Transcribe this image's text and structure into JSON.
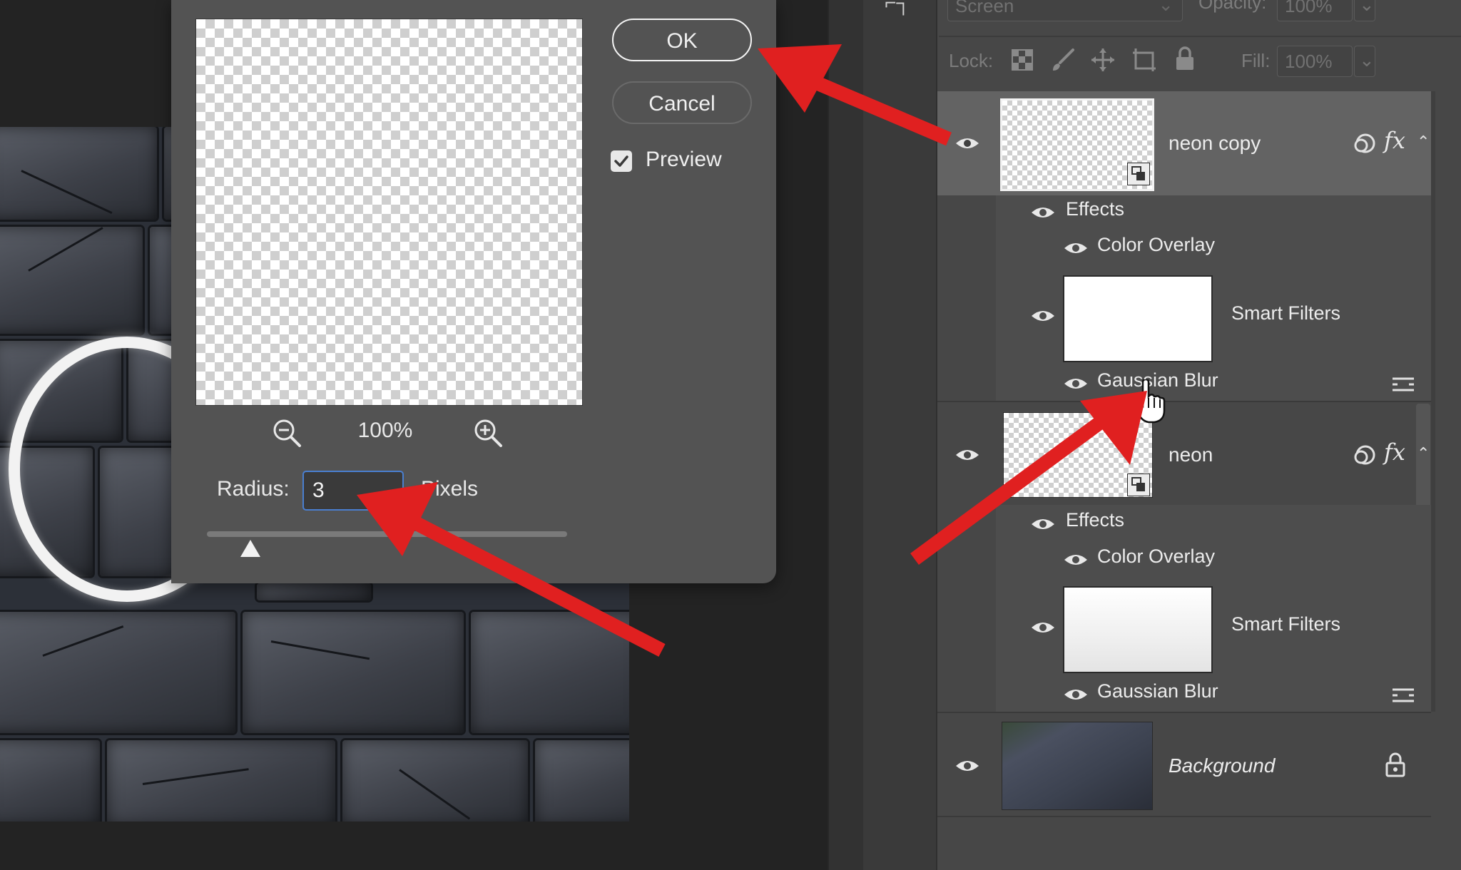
{
  "dialog": {
    "ok_label": "OK",
    "cancel_label": "Cancel",
    "preview_label": "Preview",
    "preview_checked": true,
    "zoom_level": "100%",
    "radius_label": "Radius:",
    "radius_value": "3",
    "pixels_label": "Pixels",
    "radius_slider_fraction": 0.12
  },
  "layers_panel": {
    "blend_mode": "Screen",
    "opacity_label": "Opacity:",
    "opacity_value": "100%",
    "lock_label": "Lock:",
    "fill_label": "Fill:",
    "fill_value": "100%",
    "layers": [
      {
        "name": "neon copy",
        "effects_label": "Effects",
        "effect": "Color Overlay",
        "smart_filters_label": "Smart Filters",
        "filter": "Gaussian Blur"
      },
      {
        "name": "neon",
        "effects_label": "Effects",
        "effect": "Color Overlay",
        "smart_filters_label": "Smart Filters",
        "filter": "Gaussian Blur"
      },
      {
        "name": "Background"
      }
    ],
    "fx_badge": "fx",
    "selected_layer": "neon copy"
  },
  "icons": [
    "zoom-out-icon",
    "zoom-in-icon",
    "checkbox-check-icon",
    "eye-icon",
    "lock-transparent-icon",
    "lock-brush-icon",
    "lock-move-icon",
    "lock-artboard-icon",
    "lock-all-icon",
    "smart-object-badge-icon",
    "link-icon",
    "chevron-up-icon",
    "filter-options-icon",
    "hand-cursor-icon",
    "background-lock-icon"
  ],
  "colors": {
    "annotation_arrow": "#e02020",
    "dialog_bg": "#535353",
    "panel_bg": "#474747",
    "selected_row": "#636363",
    "input_focus": "#4a7fd0"
  }
}
